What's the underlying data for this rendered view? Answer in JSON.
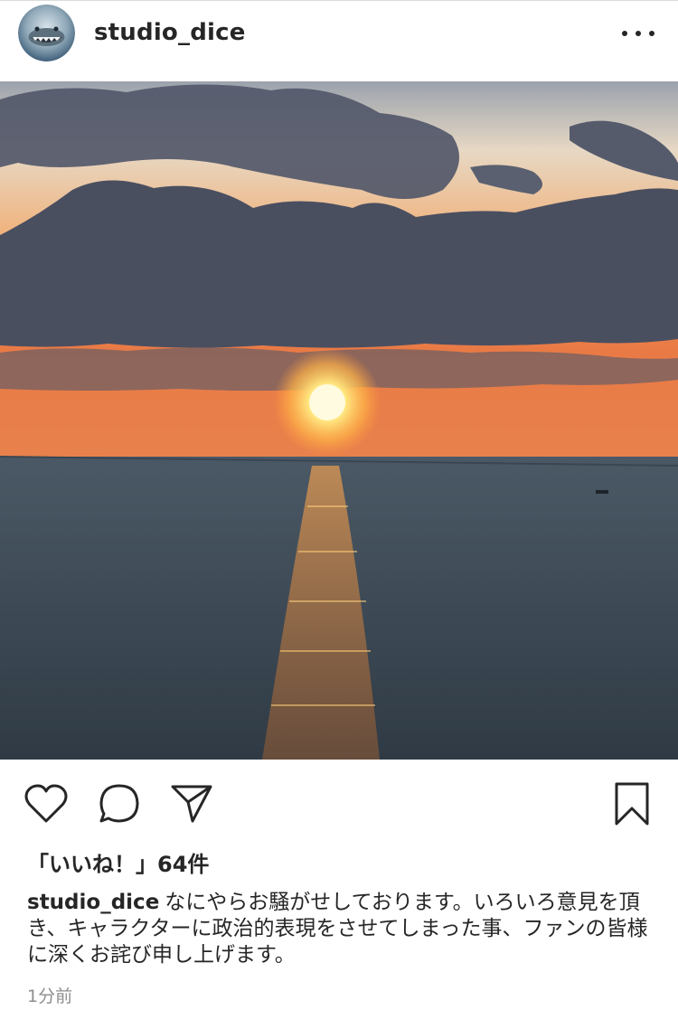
{
  "post": {
    "username": "studio_dice",
    "likes_text": "「いいね！」64件",
    "caption_user": "studio_dice",
    "caption_text": "なにやらお騒がせしております。いろいろ意見を頂き、キャラクターに政治的表現をさせてしまった事、ファンの皆様に深くお詫び申し上げます。",
    "timestamp": "1分前"
  },
  "icons": {
    "more": "more-options-icon",
    "like": "heart-icon",
    "comment": "comment-icon",
    "share": "send-icon",
    "save": "bookmark-icon"
  },
  "colors": {
    "text": "#262626",
    "muted": "#8e8e8e",
    "divider": "#dbdbdb"
  }
}
